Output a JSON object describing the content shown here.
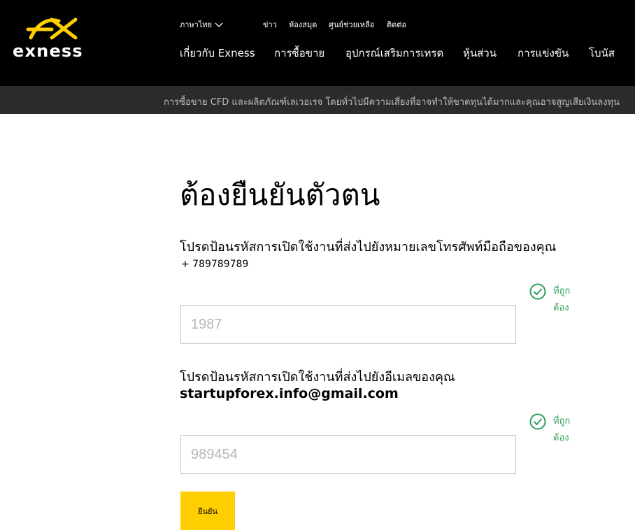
{
  "brand": {
    "logo_text": "exness",
    "accent": "#ffcf00",
    "success": "#2e9e5a"
  },
  "header": {
    "language": "ภาษาไทย",
    "util_links": [
      "ข่าว",
      "ห้องสมุด",
      "ศูนย์ช่วยเหลือ",
      "ติดต่อ"
    ],
    "main_nav": [
      "เกี่ยวกับ Exness",
      "การซื้อขาย",
      "อุปกรณ์เสริมการเทรด",
      "หุ้นส่วน",
      "การแข่งขัน",
      "โบนัส"
    ]
  },
  "risk_warning": "การซื้อขาย CFD และผลิตภัณฑ์เลเวอเรจ โดยทั่วไปมีความเสี่ยงที่อาจทำให้ขาดทุนได้มากและคุณอาจสูญเสียเงินลงทุน",
  "form": {
    "title": "ต้องยืนยันตัวตน",
    "phone_instruction": "โปรดป้อนรหัสการเปิดใช้งานที่ส่งไปยังหมายเลขโทรศัพท์มือถือของคุณ",
    "phone_number": "+ 789789789",
    "phone_code_placeholder": "1987",
    "email_instruction": "โปรดป้อนรหัสการเปิดใช้งานที่ส่งไปยังอีเมลของคุณ",
    "email": "startupforex.info@gmail.com",
    "email_code_placeholder": "989454",
    "valid_label": "ที่ถูกต้อง",
    "submit_label": "ยืนยัน"
  }
}
